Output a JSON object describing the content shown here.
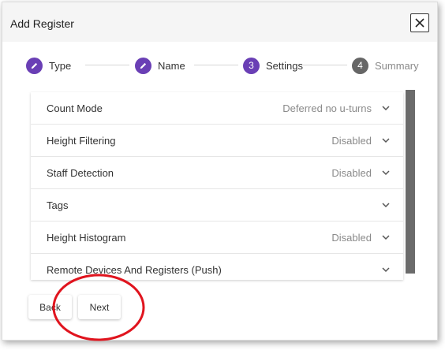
{
  "dialog": {
    "title": "Add Register",
    "close_icon": "close-icon"
  },
  "stepper": {
    "steps": [
      {
        "label": "Type",
        "marker": "pencil-icon",
        "state": "completed"
      },
      {
        "label": "Name",
        "marker": "pencil-icon",
        "state": "completed"
      },
      {
        "label": "Settings",
        "number": "3",
        "state": "active"
      },
      {
        "label": "Summary",
        "number": "4",
        "state": "inactive"
      }
    ]
  },
  "settings": {
    "rows": [
      {
        "label": "Count Mode",
        "value": "Deferred no u-turns"
      },
      {
        "label": "Height Filtering",
        "value": "Disabled"
      },
      {
        "label": "Staff Detection",
        "value": "Disabled"
      },
      {
        "label": "Tags",
        "value": ""
      },
      {
        "label": "Height Histogram",
        "value": "Disabled"
      },
      {
        "label": "Remote Devices And Registers (Push)",
        "value": ""
      }
    ]
  },
  "buttons": {
    "back_label": "Back",
    "next_label": "Next"
  },
  "colors": {
    "accent": "#6a3fb5",
    "inactive_step": "#666666",
    "highlight": "#e0141e",
    "scrollbar": "#6b6b6b"
  }
}
